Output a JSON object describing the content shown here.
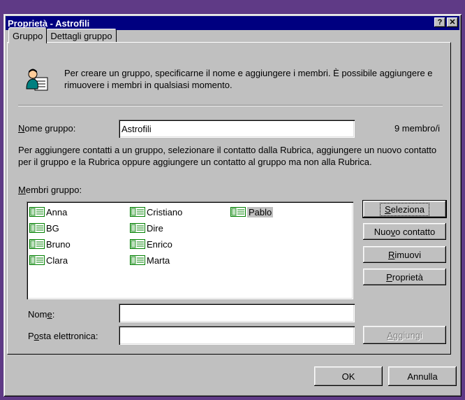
{
  "window": {
    "title": "Proprietà - Astrofili",
    "help_btn": "?",
    "close_btn": "✕"
  },
  "tabs": [
    {
      "label": "Gruppo"
    },
    {
      "label": "Dettagli gruppo"
    }
  ],
  "intro": {
    "icon": "group-people-icon",
    "text": "Per creare un gruppo, specificarne il nome e aggiungere i membri. È possibile aggiungere e rimuovere i membri in qualsiasi momento."
  },
  "group_name": {
    "label_accel": "N",
    "label_rest": "ome gruppo:",
    "value": "Astrofili",
    "count": "9 membro/i"
  },
  "description": "Per aggiungere contatti a un gruppo, selezionare il contatto dalla Rubrica, aggiungere un nuovo contatto per il gruppo e la Rubrica oppure aggiungere un contatto al gruppo ma non alla Rubrica.",
  "members_label": {
    "accel": "M",
    "rest": "embri gruppo:"
  },
  "members": [
    "Anna",
    "BG",
    "Bruno",
    "Clara",
    "Cristiano",
    "Dire",
    "Enrico",
    "Marta",
    "Pablo"
  ],
  "selected_member": "Pablo",
  "buttons": {
    "seleziona": {
      "accel": "S",
      "rest": "eleziona"
    },
    "nuovo_pre": "Nuo",
    "nuovo_accel": "v",
    "nuovo_rest": "o contatto",
    "rimuovi": {
      "accel": "R",
      "rest": "imuovi"
    },
    "proprieta": {
      "accel": "P",
      "rest": "roprietà"
    },
    "aggiungi": {
      "accel": "A",
      "rest": "ggiungi"
    },
    "ok": "OK",
    "annulla": "Annulla"
  },
  "nome_field": {
    "pre": "Nom",
    "accel": "e",
    "post": ":",
    "value": ""
  },
  "email_field": {
    "pre": "P",
    "accel": "o",
    "post": "sta elettronica:",
    "value": ""
  },
  "colors": {
    "titlebar": "#000080",
    "face": "#c0c0c0",
    "desktop": "#5f3a86"
  }
}
